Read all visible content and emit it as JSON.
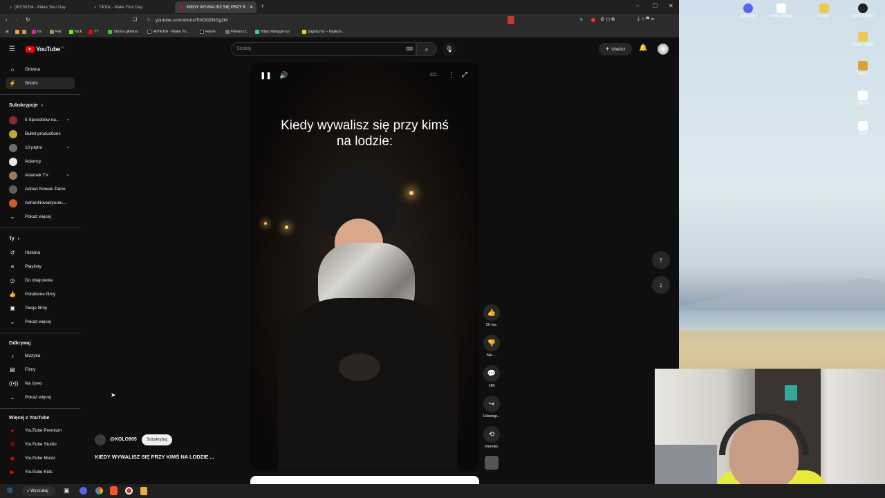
{
  "browser": {
    "tabs": [
      {
        "label": "(80)TikTok - Make Your Day"
      },
      {
        "label": "TikTok - Make Your Day"
      },
      {
        "label": "KIEDY WYWALISZ SIĘ PRZY K"
      }
    ],
    "url": "youtube.com/shorts/TiXODZNGg2M",
    "bookmarks": [
      "IG",
      "Rat",
      "Kick",
      "YT",
      "Strona główna",
      "(4)TikTok - Make Yo...",
      "Home",
      "Filman.cc",
      "https://tanggle.io/",
      "Zagraj.my – Najleps..."
    ]
  },
  "youtube": {
    "logo": "YouTube",
    "logo_region": "PL",
    "search_placeholder": "Szukaj",
    "create_label": "Utwórz",
    "sidebar": {
      "main": [
        {
          "label": "Główna",
          "icon": "home-icon"
        },
        {
          "label": "Shorts",
          "icon": "shorts-icon"
        }
      ],
      "subs_title": "Subskrypcje",
      "subs": [
        {
          "label": "5 Sposobów na...",
          "color": "#8b2a2a",
          "dot": true
        },
        {
          "label": "Bullet productions",
          "color": "#c9a23a",
          "dot": false
        },
        {
          "label": "10 piętro",
          "color": "#6d6d6d",
          "dot": true
        },
        {
          "label": "Adamcy",
          "color": "#e9e9e9",
          "dot": false
        },
        {
          "label": "Adamek TV",
          "color": "#9a7b5a",
          "dot": true
        },
        {
          "label": "Adrian Nowak Żalno",
          "color": "#5e5e5e",
          "dot": false
        },
        {
          "label": "AdrianNowakyoutu...",
          "color": "#c45e2a",
          "dot": false
        }
      ],
      "show_more": "Pokaż więcej",
      "you_title": "Ty",
      "you": [
        {
          "label": "Historia",
          "icon": "history-icon"
        },
        {
          "label": "Playlisty",
          "icon": "playlist-icon"
        },
        {
          "label": "Do obejrzenia",
          "icon": "watch-later-icon"
        },
        {
          "label": "Polubione filmy",
          "icon": "like-icon"
        },
        {
          "label": "Twoje filmy",
          "icon": "your-videos-icon"
        },
        {
          "label": "Pokaż więcej",
          "icon": "chevron-down-icon"
        }
      ],
      "explore_title": "Odkrywaj",
      "explore": [
        {
          "label": "Muzyka",
          "icon": "music-icon"
        },
        {
          "label": "Filmy",
          "icon": "film-icon"
        },
        {
          "label": "Na żywo",
          "icon": "live-icon"
        },
        {
          "label": "Pokaż więcej",
          "icon": "chevron-down-icon"
        }
      ],
      "more_title": "Więcej z YouTube",
      "more": [
        {
          "label": "YouTube Premium"
        },
        {
          "label": "YouTube Studio"
        },
        {
          "label": "YouTube Music"
        },
        {
          "label": "YouTube Kids"
        }
      ]
    },
    "short": {
      "caption": "Kiedy wywalisz się przy kimś na lodzie:",
      "channel": "@KOLO905",
      "subscribe": "Subskrybuj",
      "title": "KIEDY WYWALISZ SIĘ PRZY KIMŚ NA LODZIE ...",
      "likes": "20 tys.",
      "dislike": "Nie ...",
      "comments": "186",
      "share": "Udostęp...",
      "remix": "Remiks"
    }
  },
  "desktop": {
    "icons": [
      "Discord",
      "wideo/mody",
      "Icony",
      "OBS Studio",
      "nowe folder",
      "notes",
      "zdjęcia",
      "2024"
    ]
  },
  "taskbar": {
    "search": "Wyszukaj"
  }
}
